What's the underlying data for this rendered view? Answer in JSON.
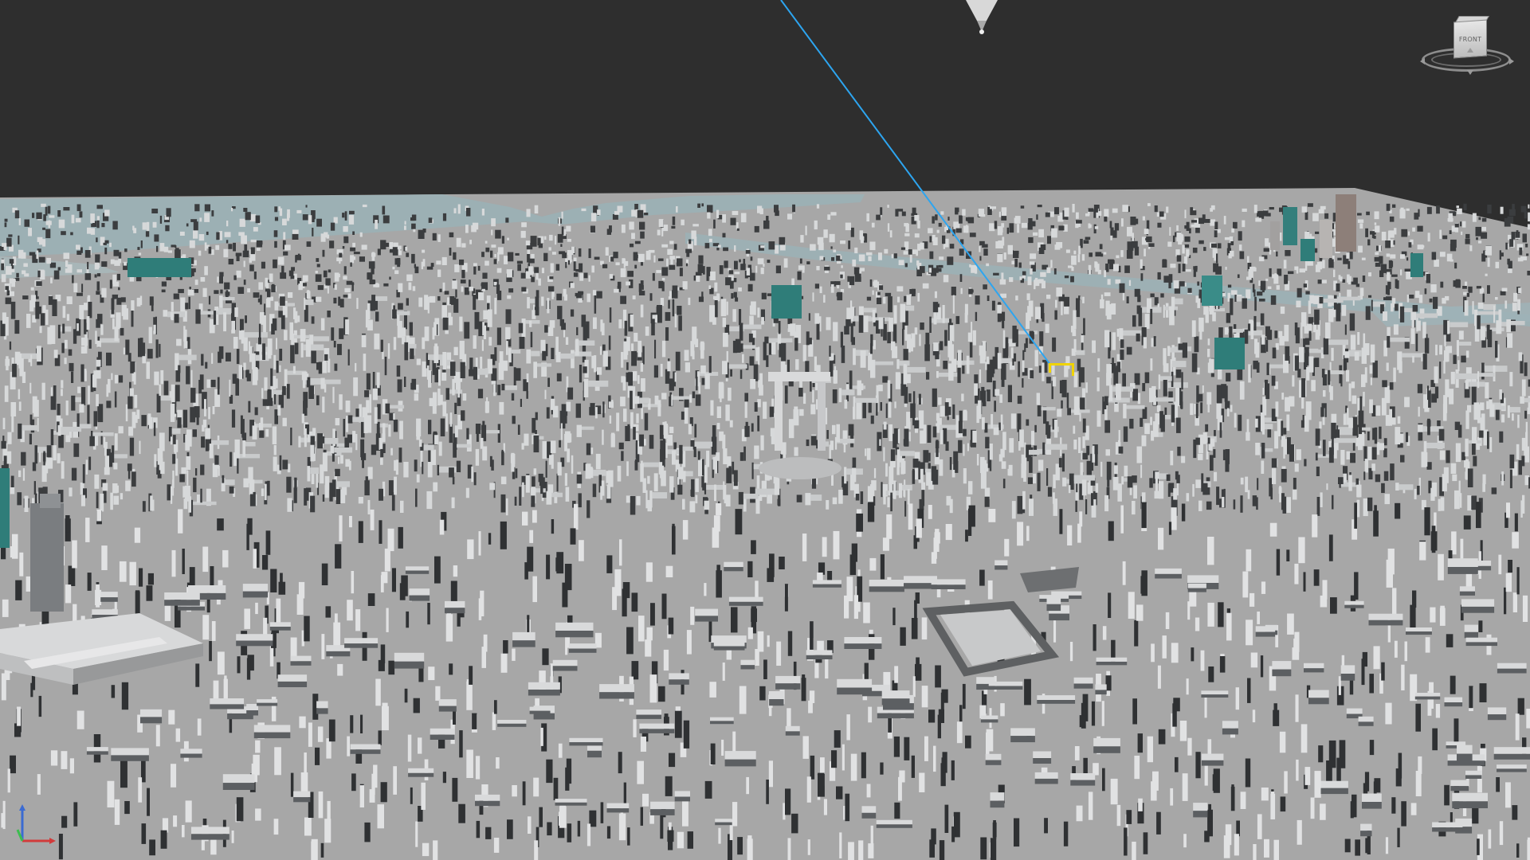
{
  "app": {
    "type": "3D viewport"
  },
  "scene": {
    "background_color": "#2e2e2e",
    "ground_color": "#a7a7a7",
    "water_color": "#9bb0b4",
    "building_light_color": "#d7d9da",
    "building_dark_color": "#3b3d3f",
    "teal_building_color": "#2f7d79",
    "camera_line_color": "#2da5f0",
    "selection_color": "#f0d300"
  },
  "viewcube": {
    "label": "FRONT",
    "icon": "viewcube-icon"
  },
  "axis": {
    "x_color": "#d23b3b",
    "y_color": "#3bbd4f",
    "z_color": "#3b6bd2",
    "icon": "axis-tripod-icon"
  }
}
